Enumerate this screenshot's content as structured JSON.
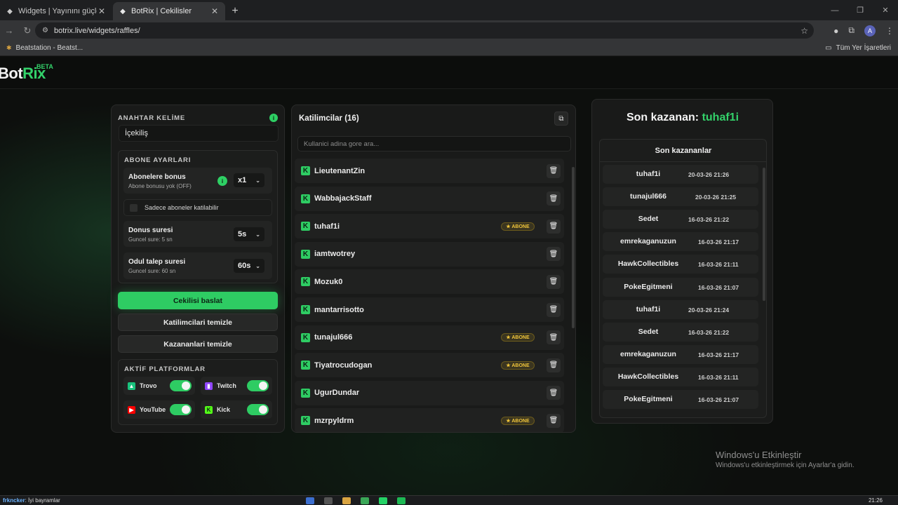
{
  "browser": {
    "tabs": [
      {
        "title": "Widgets | Yayınını güçlendirmek",
        "active": false
      },
      {
        "title": "BotRix | Cekilisler",
        "active": true
      }
    ],
    "new_tab": "+",
    "url": "botrix.live/widgets/raffles/",
    "bookmark": "Beatstation - Beatst...",
    "all_bookmarks": "Tüm Yer İşaretleri",
    "avatar": "A"
  },
  "site": {
    "logo_bot": "Bot",
    "logo_rix": "Rix",
    "beta": "BETA"
  },
  "left": {
    "keyword_label": "ANAHTAR KELİME",
    "keyword_value": "İçekiliş",
    "sub_settings_label": "ABONE AYARLARI",
    "sub_bonus": {
      "title": "Abonelere bonus",
      "subtitle": "Abone bonusu yok (OFF)",
      "value": "x1"
    },
    "only_subs": "Sadece aboneler katilabilir",
    "bonus_time": {
      "title": "Donus suresi",
      "subtitle": "Guncel sure: 5 sn",
      "value": "5s"
    },
    "claim_time": {
      "title": "Odul talep suresi",
      "subtitle": "Guncel sure: 60 sn",
      "value": "60s"
    },
    "start_button": "Cekilisi baslat",
    "clear_participants": "Katilimcilari temizle",
    "clear_winners": "Kazananlari temizle",
    "platforms_label": "AKTİF PLATFORMLAR",
    "platforms": [
      {
        "name": "Trovo",
        "enabled": true,
        "color": "#19c37d"
      },
      {
        "name": "Twitch",
        "enabled": true,
        "color": "#9146ff"
      },
      {
        "name": "YouTube",
        "enabled": true,
        "color": "#ff0000"
      },
      {
        "name": "Kick",
        "enabled": true,
        "color": "#53fc18"
      }
    ]
  },
  "participants": {
    "title": "Katilimcilar (16)",
    "search_placeholder": "Kullanici adina gore ara...",
    "badge_label": "★ ABONE",
    "list": [
      {
        "name": "LieutenantZin",
        "sub": false
      },
      {
        "name": "WabbajackStaff",
        "sub": false
      },
      {
        "name": "tuhaf1i",
        "sub": true
      },
      {
        "name": "iamtwotrey",
        "sub": false
      },
      {
        "name": "Mozuk0",
        "sub": false
      },
      {
        "name": "mantarrisotto",
        "sub": false
      },
      {
        "name": "tunajul666",
        "sub": true
      },
      {
        "name": "Tiyatrocudogan",
        "sub": true
      },
      {
        "name": "UgurDundar",
        "sub": false
      },
      {
        "name": "mzrpyldrm",
        "sub": true
      }
    ]
  },
  "winners": {
    "last_winner_prefix": "Son kazanan:",
    "last_winner": "tuhaf1i",
    "list_title": "Son kazananlar",
    "list": [
      {
        "name": "tuhaf1i",
        "date": "20-03-26 21:26"
      },
      {
        "name": "tunajul666",
        "date": "20-03-26 21:25"
      },
      {
        "name": "Sedet",
        "date": "16-03-26 21:22"
      },
      {
        "name": "emrekaganuzun",
        "date": "16-03-26 21:17"
      },
      {
        "name": "HawkCollectibles",
        "date": "16-03-26 21:11"
      },
      {
        "name": "PokeEgitmeni",
        "date": "16-03-26 21:07"
      },
      {
        "name": "tuhaf1i",
        "date": "20-03-26 21:24"
      },
      {
        "name": "Sedet",
        "date": "16-03-26 21:22"
      },
      {
        "name": "emrekaganuzun",
        "date": "16-03-26 21:17"
      },
      {
        "name": "HawkCollectibles",
        "date": "16-03-26 21:11"
      },
      {
        "name": "PokeEgitmeni",
        "date": "16-03-26 21:07"
      }
    ]
  },
  "watermark": {
    "line1": "Windows'u Etkinleştir",
    "line2": "Windows'u etkinleştirmek için Ayarlar'a gidin."
  },
  "taskbar": {
    "ticker_user": "frkncker",
    "ticker_text": ": İyi bayramlar",
    "clock": "21:26"
  }
}
